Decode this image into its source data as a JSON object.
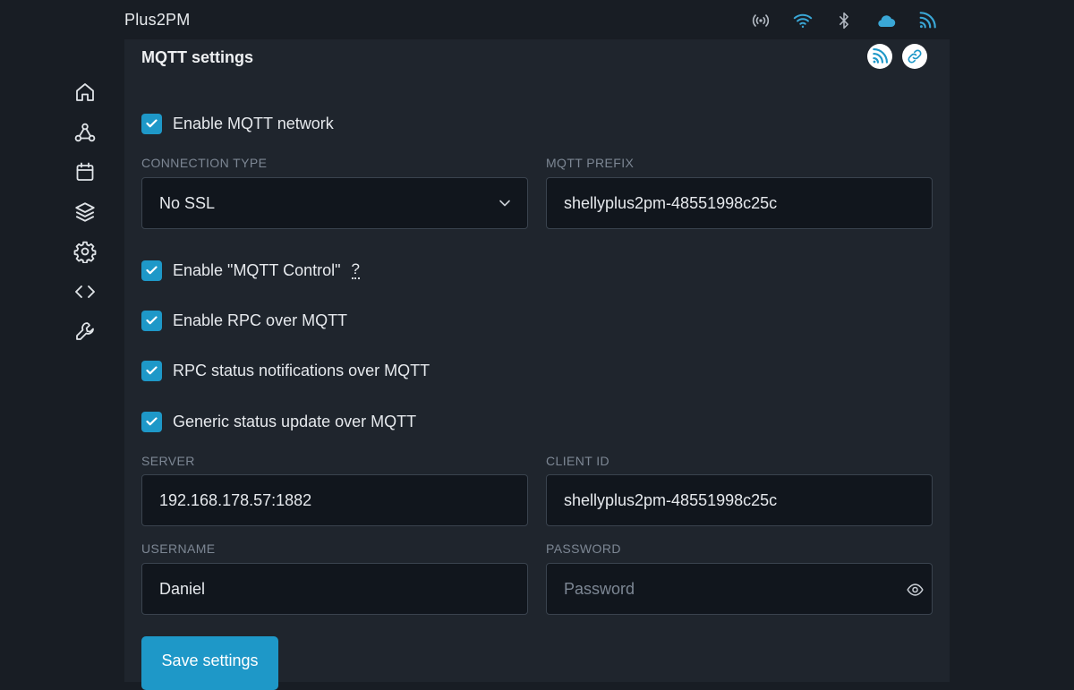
{
  "app": {
    "title": "Plus2PM"
  },
  "status_icons": [
    "broadcast-icon",
    "wifi-icon",
    "bluetooth-icon",
    "cloud-icon",
    "mqtt-rss-icon"
  ],
  "sidebar": {
    "items": [
      "home-icon",
      "webhooks-icon",
      "calendar-icon",
      "layers-icon",
      "gear-icon",
      "code-icon",
      "wrench-icon"
    ]
  },
  "panel": {
    "title": "MQTT settings",
    "actions": [
      "mqtt-rss-icon",
      "link-icon"
    ]
  },
  "form": {
    "enable_mqtt": {
      "label": "Enable MQTT network",
      "checked": true
    },
    "connection_type": {
      "label": "CONNECTION TYPE",
      "value": "No SSL"
    },
    "mqtt_prefix": {
      "label": "MQTT PREFIX",
      "value": "shellyplus2pm-48551998c25c"
    },
    "enable_control": {
      "label": "Enable \"MQTT Control\"",
      "checked": true,
      "help": "?"
    },
    "enable_rpc": {
      "label": "Enable RPC over MQTT",
      "checked": true
    },
    "rpc_notifications": {
      "label": "RPC status notifications over MQTT",
      "checked": true
    },
    "generic_status": {
      "label": "Generic status update over MQTT",
      "checked": true
    },
    "server": {
      "label": "SERVER",
      "value": "192.168.178.57:1882"
    },
    "client_id": {
      "label": "CLIENT ID",
      "value": "shellyplus2pm-48551998c25c"
    },
    "username": {
      "label": "USERNAME",
      "value": "Daniel"
    },
    "password": {
      "label": "PASSWORD",
      "value": "",
      "placeholder": "Password"
    },
    "save_label": "Save settings"
  },
  "colors": {
    "accent": "#1e98c8",
    "background": "#181d24",
    "panel": "#1f252d",
    "field": "#11161d"
  }
}
